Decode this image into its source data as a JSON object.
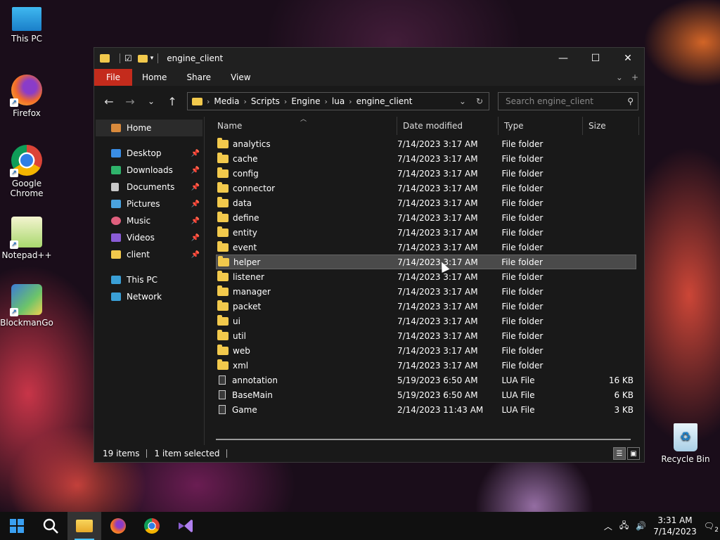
{
  "desktop": {
    "icons": [
      {
        "label": "This PC",
        "icon": "monitor-icon"
      },
      {
        "label": "Firefox",
        "icon": "firefox-icon"
      },
      {
        "label": "Google Chrome",
        "icon": "chrome-icon"
      },
      {
        "label": "Notepad++",
        "icon": "notepadpp-icon"
      },
      {
        "label": "BlockmanGo",
        "icon": "blockmango-icon"
      },
      {
        "label": "Recycle Bin",
        "icon": "recycle-bin-icon"
      }
    ]
  },
  "window": {
    "title": "engine_client",
    "ribbon_tabs": [
      "File",
      "Home",
      "Share",
      "View"
    ],
    "breadcrumb": [
      "Media",
      "Scripts",
      "Engine",
      "lua",
      "engine_client"
    ],
    "search_placeholder": "Search engine_client",
    "sidebar": {
      "home": "Home",
      "quick_access": [
        {
          "label": "Desktop",
          "icon": "desktop-icon",
          "color": "#3a8ee6"
        },
        {
          "label": "Downloads",
          "icon": "download-icon",
          "color": "#2fb36b"
        },
        {
          "label": "Documents",
          "icon": "documents-icon",
          "color": "#c9c9c9"
        },
        {
          "label": "Pictures",
          "icon": "pictures-icon",
          "color": "#4aa3df"
        },
        {
          "label": "Music",
          "icon": "music-icon",
          "color": "#e0607e"
        },
        {
          "label": "Videos",
          "icon": "videos-icon",
          "color": "#8a5cd6"
        },
        {
          "label": "client",
          "icon": "folder-icon",
          "color": "#f2c94c"
        }
      ],
      "this_pc": "This PC",
      "network": "Network"
    },
    "columns": [
      "Name",
      "Date modified",
      "Type",
      "Size"
    ],
    "files": [
      {
        "name": "analytics",
        "date": "7/14/2023 3:17 AM",
        "type": "File folder",
        "size": "",
        "kind": "folder"
      },
      {
        "name": "cache",
        "date": "7/14/2023 3:17 AM",
        "type": "File folder",
        "size": "",
        "kind": "folder"
      },
      {
        "name": "config",
        "date": "7/14/2023 3:17 AM",
        "type": "File folder",
        "size": "",
        "kind": "folder"
      },
      {
        "name": "connector",
        "date": "7/14/2023 3:17 AM",
        "type": "File folder",
        "size": "",
        "kind": "folder"
      },
      {
        "name": "data",
        "date": "7/14/2023 3:17 AM",
        "type": "File folder",
        "size": "",
        "kind": "folder"
      },
      {
        "name": "define",
        "date": "7/14/2023 3:17 AM",
        "type": "File folder",
        "size": "",
        "kind": "folder"
      },
      {
        "name": "entity",
        "date": "7/14/2023 3:17 AM",
        "type": "File folder",
        "size": "",
        "kind": "folder"
      },
      {
        "name": "event",
        "date": "7/14/2023 3:17 AM",
        "type": "File folder",
        "size": "",
        "kind": "folder"
      },
      {
        "name": "helper",
        "date": "7/14/2023 3:17 AM",
        "type": "File folder",
        "size": "",
        "kind": "folder",
        "selected": true
      },
      {
        "name": "listener",
        "date": "7/14/2023 3:17 AM",
        "type": "File folder",
        "size": "",
        "kind": "folder"
      },
      {
        "name": "manager",
        "date": "7/14/2023 3:17 AM",
        "type": "File folder",
        "size": "",
        "kind": "folder"
      },
      {
        "name": "packet",
        "date": "7/14/2023 3:17 AM",
        "type": "File folder",
        "size": "",
        "kind": "folder"
      },
      {
        "name": "ui",
        "date": "7/14/2023 3:17 AM",
        "type": "File folder",
        "size": "",
        "kind": "folder"
      },
      {
        "name": "util",
        "date": "7/14/2023 3:17 AM",
        "type": "File folder",
        "size": "",
        "kind": "folder"
      },
      {
        "name": "web",
        "date": "7/14/2023 3:17 AM",
        "type": "File folder",
        "size": "",
        "kind": "folder"
      },
      {
        "name": "xml",
        "date": "7/14/2023 3:17 AM",
        "type": "File folder",
        "size": "",
        "kind": "folder"
      },
      {
        "name": "annotation",
        "date": "5/19/2023 6:50 AM",
        "type": "LUA File",
        "size": "16 KB",
        "kind": "file"
      },
      {
        "name": "BaseMain",
        "date": "5/19/2023 6:50 AM",
        "type": "LUA File",
        "size": "6 KB",
        "kind": "file"
      },
      {
        "name": "Game",
        "date": "2/14/2023 11:43 AM",
        "type": "LUA File",
        "size": "3 KB",
        "kind": "file"
      }
    ],
    "status": {
      "items": "19 items",
      "selected": "1 item selected"
    }
  },
  "taskbar": {
    "apps": [
      "start-icon",
      "search-icon",
      "file-explorer-icon",
      "firefox-icon",
      "chrome-icon",
      "visual-studio-icon"
    ],
    "time": "3:31 AM",
    "date": "7/14/2023",
    "notifications": "2"
  },
  "colors": {
    "accent": "#c42b1c",
    "folder": "#f2c94c",
    "selection": "#4a4a4a"
  }
}
